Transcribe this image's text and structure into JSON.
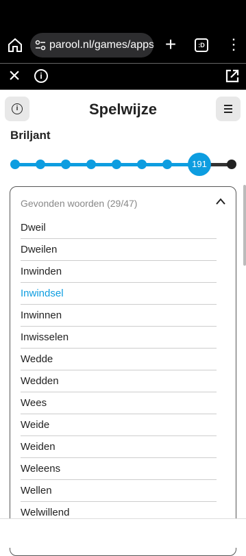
{
  "browser": {
    "url": "parool.nl/games/apps/",
    "tabs_label": ":D"
  },
  "header": {
    "title": "Spelwijze"
  },
  "rank": {
    "label": "Briljant"
  },
  "progress": {
    "score": "191",
    "steps_reached": 8,
    "steps_total": 9
  },
  "found": {
    "header": "Gevonden woorden (29/47)",
    "words": [
      {
        "text": "Dweil",
        "highlight": false
      },
      {
        "text": "Dweilen",
        "highlight": false
      },
      {
        "text": "Inwinden",
        "highlight": false
      },
      {
        "text": "Inwindsel",
        "highlight": true
      },
      {
        "text": "Inwinnen",
        "highlight": false
      },
      {
        "text": "Inwisselen",
        "highlight": false
      },
      {
        "text": "Wedde",
        "highlight": false
      },
      {
        "text": "Wedden",
        "highlight": false
      },
      {
        "text": "Wees",
        "highlight": false
      },
      {
        "text": "Weide",
        "highlight": false
      },
      {
        "text": "Weiden",
        "highlight": false
      },
      {
        "text": "Weleens",
        "highlight": false
      },
      {
        "text": "Wellen",
        "highlight": false
      },
      {
        "text": "Welwillend",
        "highlight": false
      }
    ]
  },
  "colors": {
    "accent": "#0d9de0"
  }
}
